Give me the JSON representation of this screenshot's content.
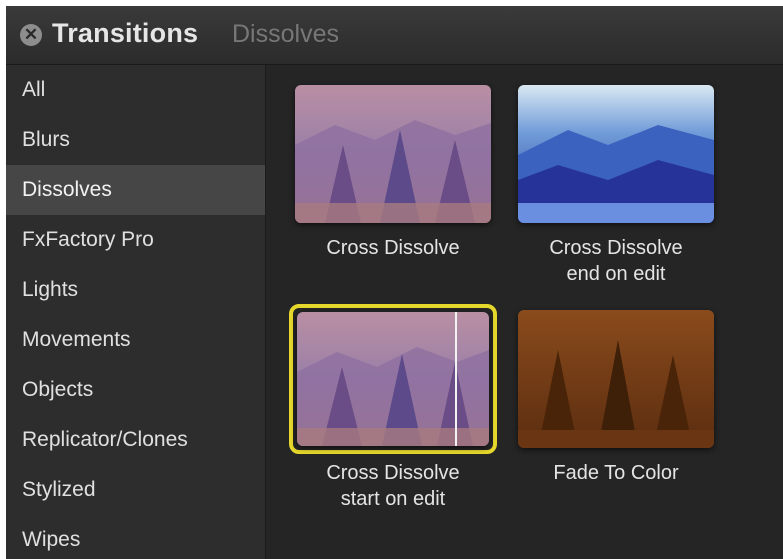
{
  "header": {
    "title": "Transitions",
    "category": "Dissolves"
  },
  "sidebar": {
    "items": [
      {
        "label": "All"
      },
      {
        "label": "Blurs"
      },
      {
        "label": "Dissolves",
        "selected": true
      },
      {
        "label": "FxFactory Pro"
      },
      {
        "label": "Lights"
      },
      {
        "label": "Movements"
      },
      {
        "label": "Objects"
      },
      {
        "label": "Replicator/Clones"
      },
      {
        "label": "Stylized"
      },
      {
        "label": "Wipes"
      }
    ]
  },
  "transitions": [
    {
      "label_line1": "Cross Dissolve",
      "label_line2": ""
    },
    {
      "label_line1": "Cross Dissolve",
      "label_line2": "end on edit"
    },
    {
      "label_line1": "Cross Dissolve",
      "label_line2": "start on edit",
      "selected": true
    },
    {
      "label_line1": "Fade To Color",
      "label_line2": ""
    }
  ],
  "colors": {
    "selection_border": "#e5d72b",
    "selected_row": "#464646",
    "background": "#2a2a2a"
  }
}
